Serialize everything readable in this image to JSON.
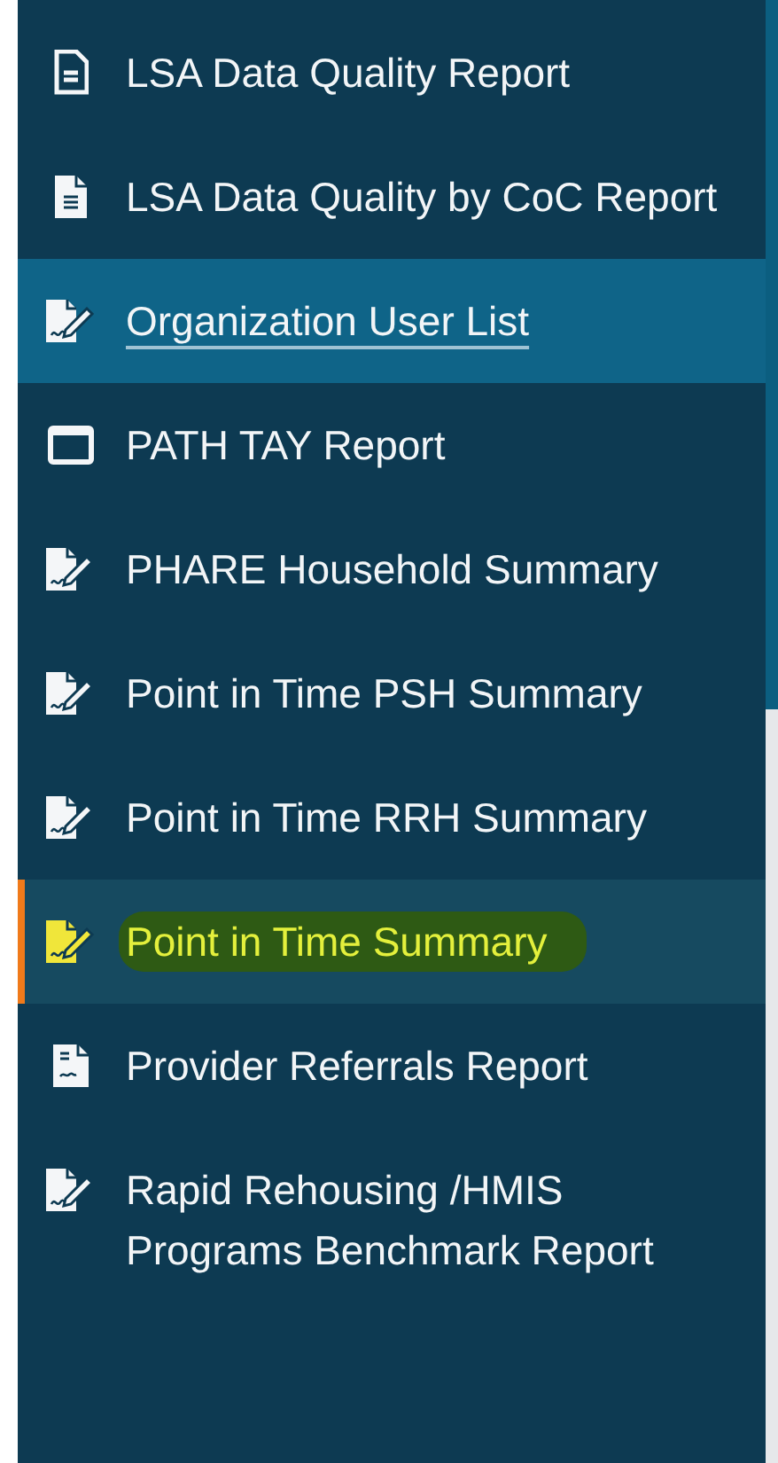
{
  "sidebar": {
    "items": [
      {
        "label": "LSA Data Quality Report",
        "kind": "report",
        "selected": false,
        "hovered": false,
        "highlighted": false
      },
      {
        "label": "LSA Data Quality by CoC Report",
        "kind": "document",
        "selected": false,
        "hovered": false,
        "highlighted": false
      },
      {
        "label": "Organization User List",
        "kind": "signature",
        "selected": false,
        "hovered": true,
        "highlighted": false
      },
      {
        "label": "PATH TAY Report",
        "kind": "window",
        "selected": false,
        "hovered": false,
        "highlighted": false
      },
      {
        "label": "PHARE Household Summary",
        "kind": "signature",
        "selected": false,
        "hovered": false,
        "highlighted": false
      },
      {
        "label": "Point in Time PSH Summary",
        "kind": "signature",
        "selected": false,
        "hovered": false,
        "highlighted": false
      },
      {
        "label": "Point in Time RRH Summary",
        "kind": "signature",
        "selected": false,
        "hovered": false,
        "highlighted": false
      },
      {
        "label": "Point in Time Summary",
        "kind": "signature",
        "selected": true,
        "hovered": false,
        "highlighted": true
      },
      {
        "label": "Provider Referrals Report",
        "kind": "signed-document",
        "selected": false,
        "hovered": false,
        "highlighted": false
      },
      {
        "label": "Rapid Rehousing /HMIS Programs Benchmark Report",
        "kind": "signature",
        "selected": false,
        "hovered": false,
        "highlighted": false
      }
    ]
  }
}
